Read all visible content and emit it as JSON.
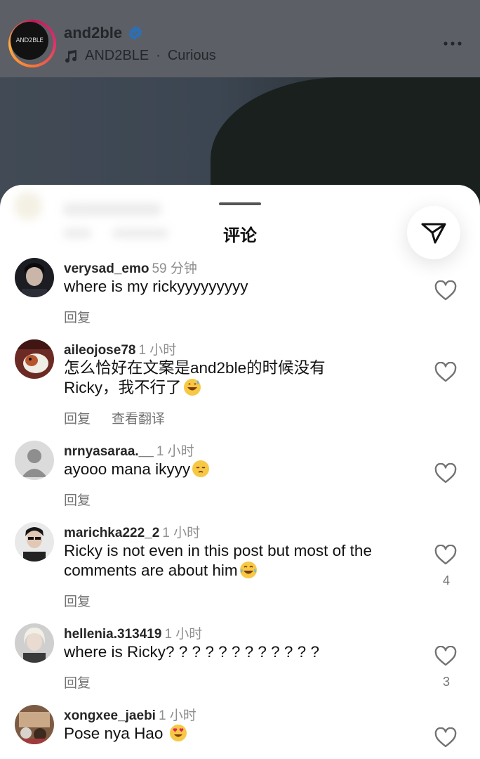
{
  "post": {
    "username": "and2ble",
    "verified": true,
    "logo_text": "AND2BLE",
    "audio_artist": "AND2BLE",
    "audio_separator": "·",
    "audio_track": "Curious"
  },
  "sheet": {
    "title": "评论"
  },
  "comments": [
    {
      "username": "verysad_emo",
      "time": "59 分钟",
      "text": "where is my rickyyyyyyyyy",
      "reply_label": "回复",
      "likes": ""
    },
    {
      "username": "aileojose78",
      "time": "1 小时",
      "text": "怎么恰好在文案是and2ble的时候没有Ricky，我不行了",
      "emoji": "grinning-sweat",
      "reply_label": "回复",
      "translate_label": "查看翻译",
      "likes": ""
    },
    {
      "username": "nrnyasaraa.__",
      "time": "1 小时",
      "text": "ayooo mana ikyyy",
      "emoji": "pensive",
      "reply_label": "回复",
      "likes": ""
    },
    {
      "username": "marichka222_2",
      "time": "1 小时",
      "text": "Ricky is not even in this post but most of the comments are about him",
      "emoji": "tears-of-joy",
      "reply_label": "回复",
      "likes": "4"
    },
    {
      "username": "hellenia.313419",
      "time": "1 小时",
      "text": "where is Ricky? ? ? ? ? ? ? ? ? ? ? ?",
      "reply_label": "回复",
      "likes": "3"
    },
    {
      "username": "xongxee_jaebi",
      "time": "1 小时",
      "text": "Pose nya Hao",
      "emoji": "heart-eyes",
      "likes": ""
    }
  ],
  "colors": {
    "verified": "#3897f0",
    "text_primary": "#111111",
    "text_secondary": "#737373"
  }
}
